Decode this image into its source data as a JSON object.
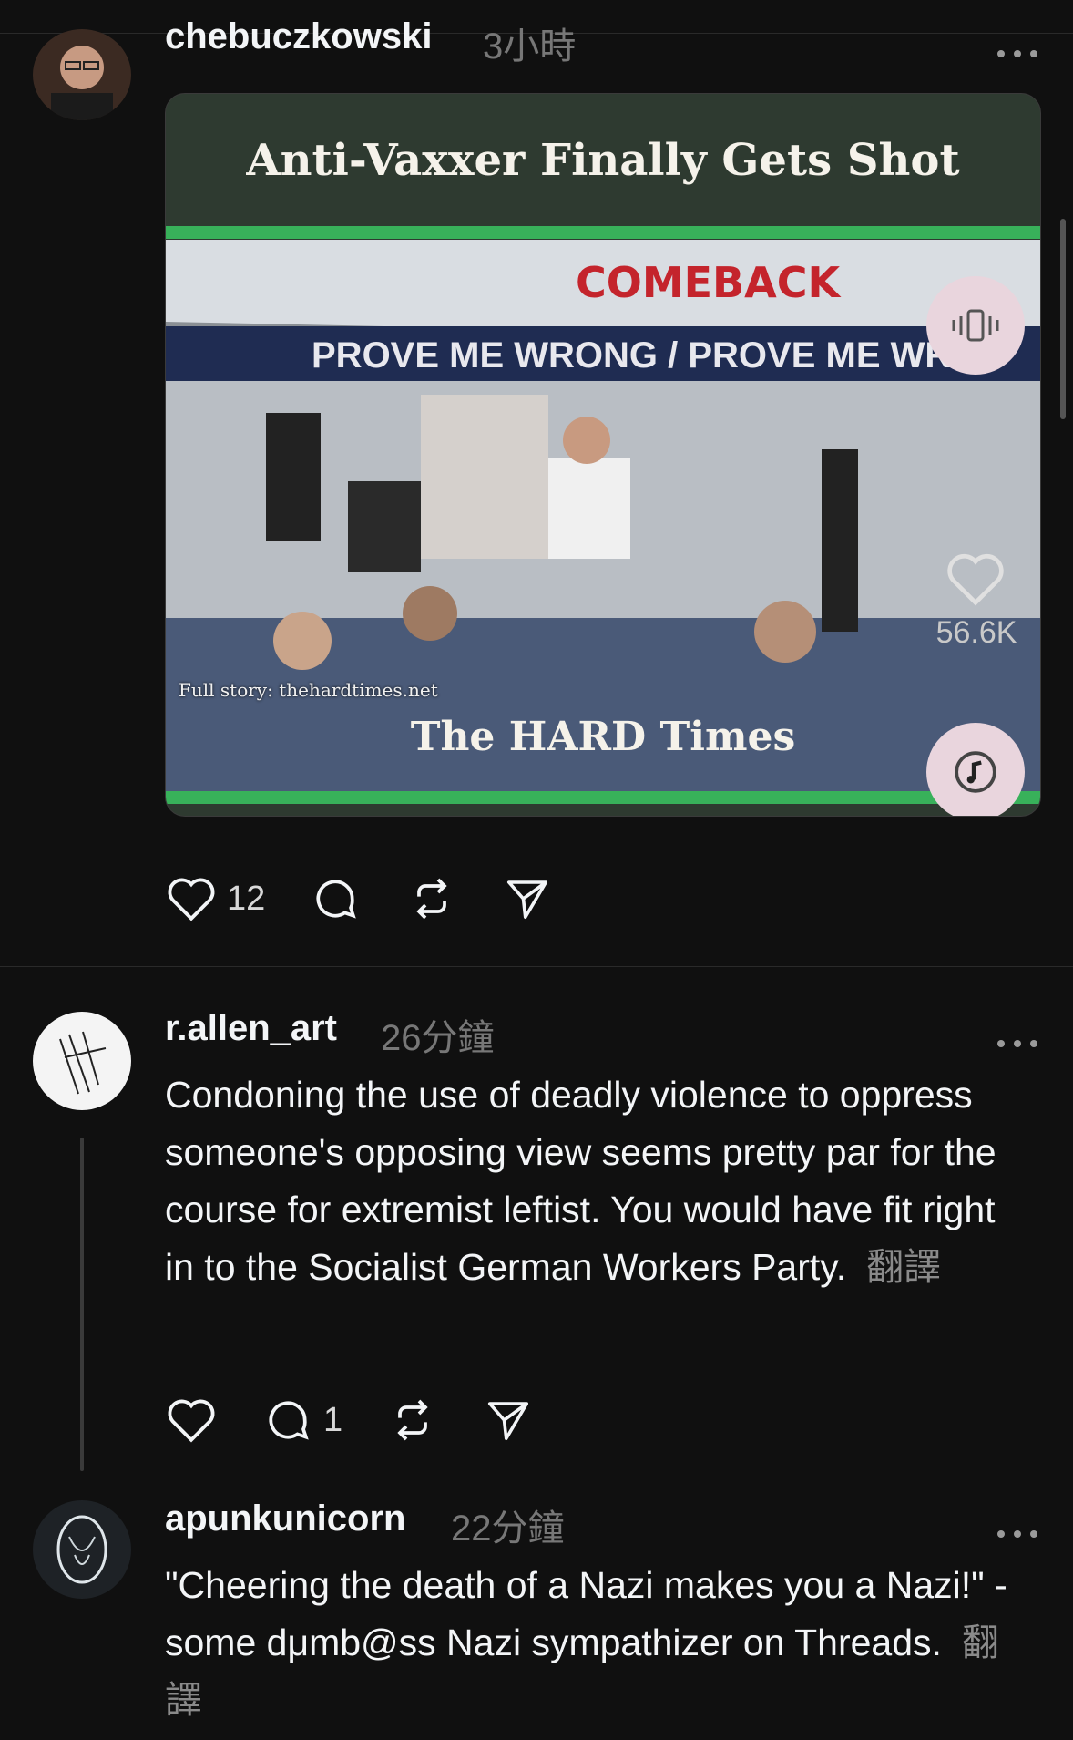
{
  "posts": [
    {
      "username": "chebuczkowski",
      "timestamp": "3小時",
      "media": {
        "title": "Anti-Vaxxer Finally Gets Shot",
        "caption": "Full story: thehardtimes.net",
        "brand": "The HARD Times",
        "tent_text_1": "COMEBACK",
        "tent_text_2": "PROVE ME WRONG / PROVE ME WRO",
        "overlay_likes": "56.6K"
      },
      "likes": "12"
    },
    {
      "username": "r.allen_art",
      "timestamp": "26分鐘",
      "text": "Condoning the use of deadly violence to oppress someone's opposing view seems pretty par for the course for extremist leftist. You would have fit right in to the Socialist German Workers Party.",
      "translate": "翻譯",
      "replies": "1"
    },
    {
      "username": "apunkunicorn",
      "timestamp": "22分鐘",
      "text": "\"Cheering the death of a Nazi makes you a Nazi!\" - some dμmb@ss Nazi sympathizer on Threads.",
      "translate": "翻譯"
    }
  ],
  "colors": {
    "background": "#101010",
    "accent_green": "#38b15a",
    "card_bg": "#2e3a30"
  }
}
